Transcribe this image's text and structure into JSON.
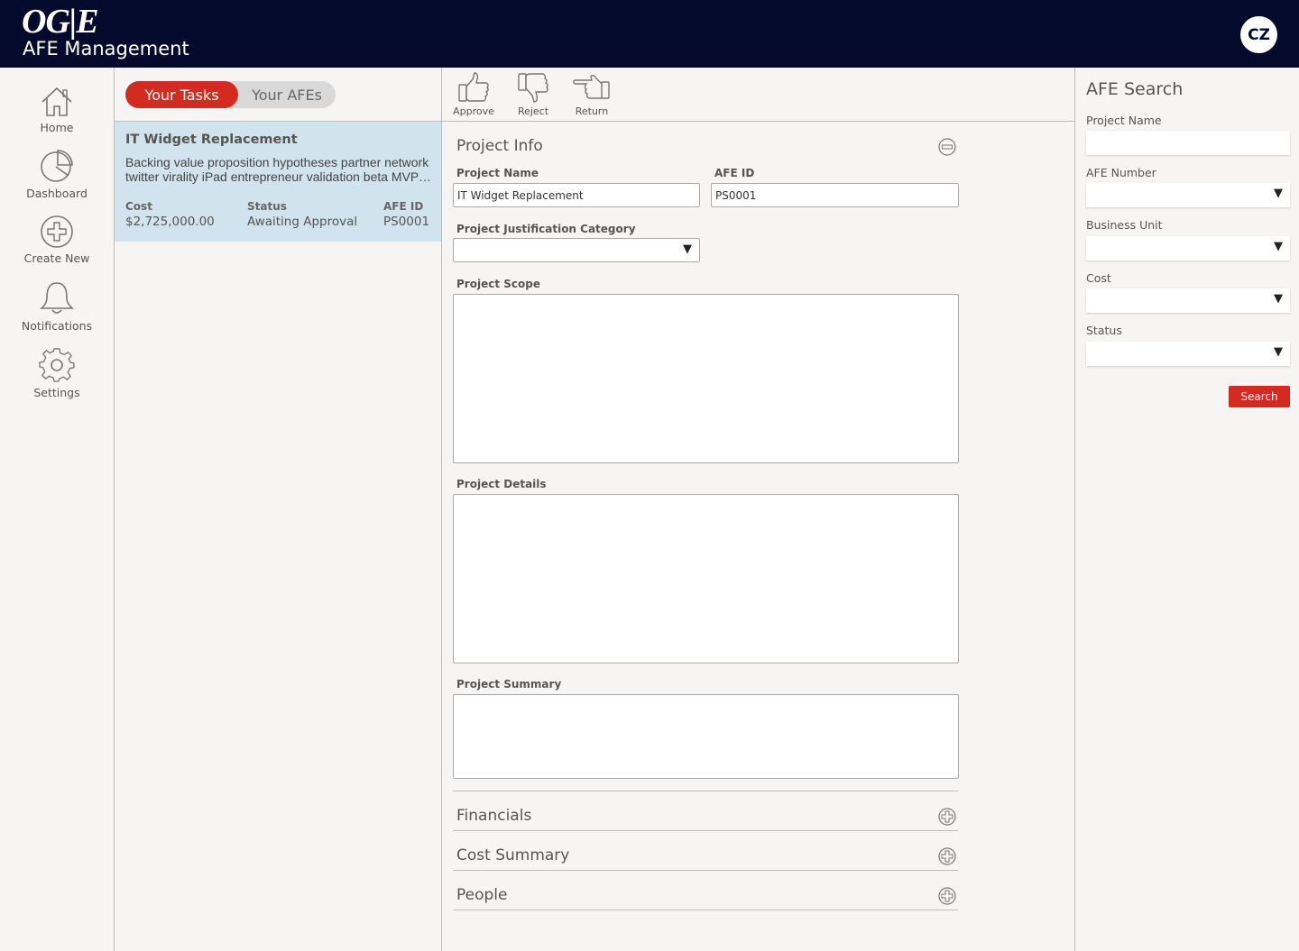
{
  "header": {
    "logo": "OG|E",
    "app_title": "AFE Management",
    "user_initials": "CZ"
  },
  "nav": {
    "items": [
      {
        "label": "Home",
        "icon": "home-icon"
      },
      {
        "label": "Dashboard",
        "icon": "pie-chart-icon"
      },
      {
        "label": "Create New",
        "icon": "plus-circle-icon"
      },
      {
        "label": "Notifications",
        "icon": "bell-icon"
      },
      {
        "label": "Settings",
        "icon": "gear-icon"
      }
    ]
  },
  "tasks": {
    "toggle": {
      "active": "Your Tasks",
      "inactive": "Your AFEs"
    },
    "items": [
      {
        "title": "IT Widget Replacement",
        "description_line1": "Backing value proposition hypotheses partner network",
        "description_line2": "twitter virality iPad entrepreneur validation beta MVP funnel",
        "cost_label": "Cost",
        "cost": "$2,725,000.00",
        "status_label": "Status",
        "status": "Awaiting Approval",
        "afe_id_label": "AFE ID",
        "afe_id": "PS0001"
      }
    ]
  },
  "toolbar": {
    "approve": "Approve",
    "reject": "Reject",
    "return": "Return"
  },
  "form": {
    "section_title": "Project Info",
    "project_name_label": "Project Name",
    "project_name_value": "IT Widget Replacement",
    "afe_id_label": "AFE ID",
    "afe_id_value": "PS0001",
    "justification_label": "Project Justification Category",
    "justification_value": "",
    "scope_label": "Project Scope",
    "details_label": "Project Details",
    "summary_label": "Project Summary",
    "collapsed_sections": [
      "Financials",
      "Cost Summary",
      "People"
    ]
  },
  "search": {
    "title": "AFE Search",
    "project_name_label": "Project Name",
    "project_name_value": "",
    "afe_number_label": "AFE Number",
    "business_unit_label": "Business Unit",
    "cost_label": "Cost",
    "status_label": "Status",
    "button": "Search"
  },
  "colors": {
    "header_bg": "#040a2b",
    "accent_red": "#d42a1f",
    "selected_card": "#d1e3ec",
    "page_bg": "#f6f5f3"
  }
}
